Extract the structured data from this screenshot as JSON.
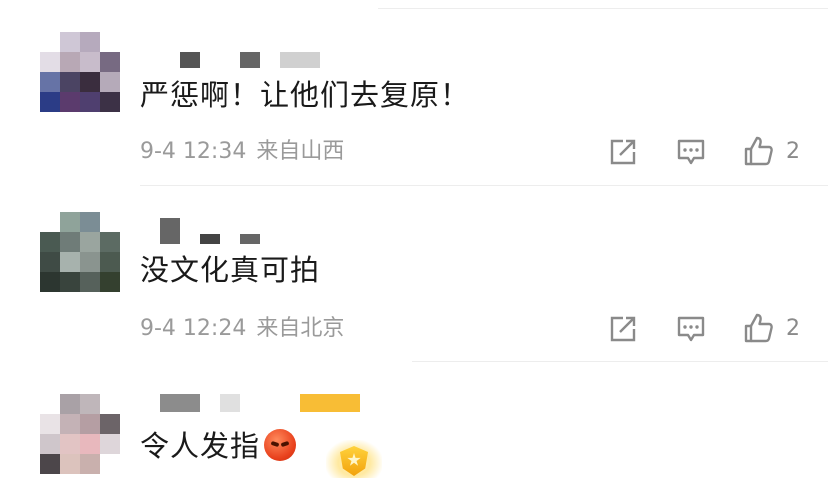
{
  "comments": [
    {
      "text": "严惩啊！让他们去复原！",
      "date": "9-4 12:34",
      "location": "来自山西",
      "like_count": "2"
    },
    {
      "text": "没文化真可拍",
      "date": "9-4 12:24",
      "location": "来自北京",
      "like_count": "2"
    },
    {
      "text": "令人发指",
      "emoji": "angry-face-emoji"
    }
  ],
  "icons": {
    "share": "share-icon",
    "reply": "comment-icon",
    "like": "thumbs-up-icon",
    "badge": "fan-badge-icon"
  },
  "colors": {
    "text": "#1a1a1a",
    "meta": "#9a9a9a",
    "icon": "#8a8a8a",
    "divider": "#ededed",
    "badge_gold": "#f2a20c",
    "nick_orange": "#f8bd35"
  }
}
